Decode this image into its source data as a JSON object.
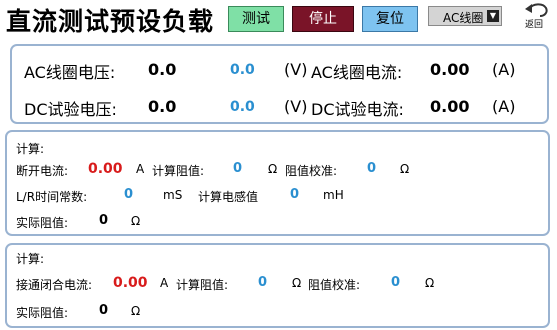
{
  "header": {
    "title": "直流测试预设负载",
    "test_label": "测试",
    "stop_label": "停止",
    "reset_label": "复位",
    "mode_value": "AC线圈",
    "back_label": "返回"
  },
  "top_panel": {
    "ac_voltage_label": "AC线圈电压:",
    "ac_voltage_value": "0.0",
    "ac_voltage_set": "0.0",
    "ac_voltage_unit": "(V)",
    "ac_current_label": "AC线圈电流:",
    "ac_current_value": "0.00",
    "ac_current_unit": "(A)",
    "dc_voltage_label": "DC试验电压:",
    "dc_voltage_value": "0.0",
    "dc_voltage_set": "0.0",
    "dc_voltage_unit": "(V)",
    "dc_current_label": "DC试验电流:",
    "dc_current_value": "0.00",
    "dc_current_unit": "(A)"
  },
  "break_panel": {
    "section_label": "计算:",
    "break_current_label": "断开电流:",
    "break_current_value": "0.00",
    "break_current_unit": "A",
    "calc_res_label": "计算阻值:",
    "calc_res_value": "0",
    "calc_res_unit": "Ω",
    "res_cal_label": "阻值校准:",
    "res_cal_value": "0",
    "res_cal_unit": "Ω",
    "lr_label": "L/R时间常数:",
    "lr_value": "0",
    "lr_unit": "mS",
    "calc_ind_label": "计算电感值",
    "calc_ind_value": "0",
    "calc_ind_unit": "mH",
    "actual_res_label": "实际阻值:",
    "actual_res_value": "0",
    "actual_res_unit": "Ω"
  },
  "close_panel": {
    "section_label": "计算:",
    "close_current_label": "接通闭合电流:",
    "close_current_value": "0.00",
    "close_current_unit": "A",
    "calc_res_label": "计算阻值:",
    "calc_res_value": "0",
    "calc_res_unit": "Ω",
    "res_cal_label": "阻值校准:",
    "res_cal_value": "0",
    "res_cal_unit": "Ω",
    "actual_res_label": "实际阻值:",
    "actual_res_value": "0",
    "actual_res_unit": "Ω"
  },
  "colors": {
    "test_button": "#7fe0a6",
    "stop_button": "#7a1428",
    "reset_button": "#7ec3f0",
    "panel_border": "#9ab3d1",
    "value_blue": "#2a8fd0",
    "value_red": "#d81b1b"
  },
  "icons": {
    "back": "return-arrow-icon",
    "dropdown": "triangle-down-icon"
  }
}
